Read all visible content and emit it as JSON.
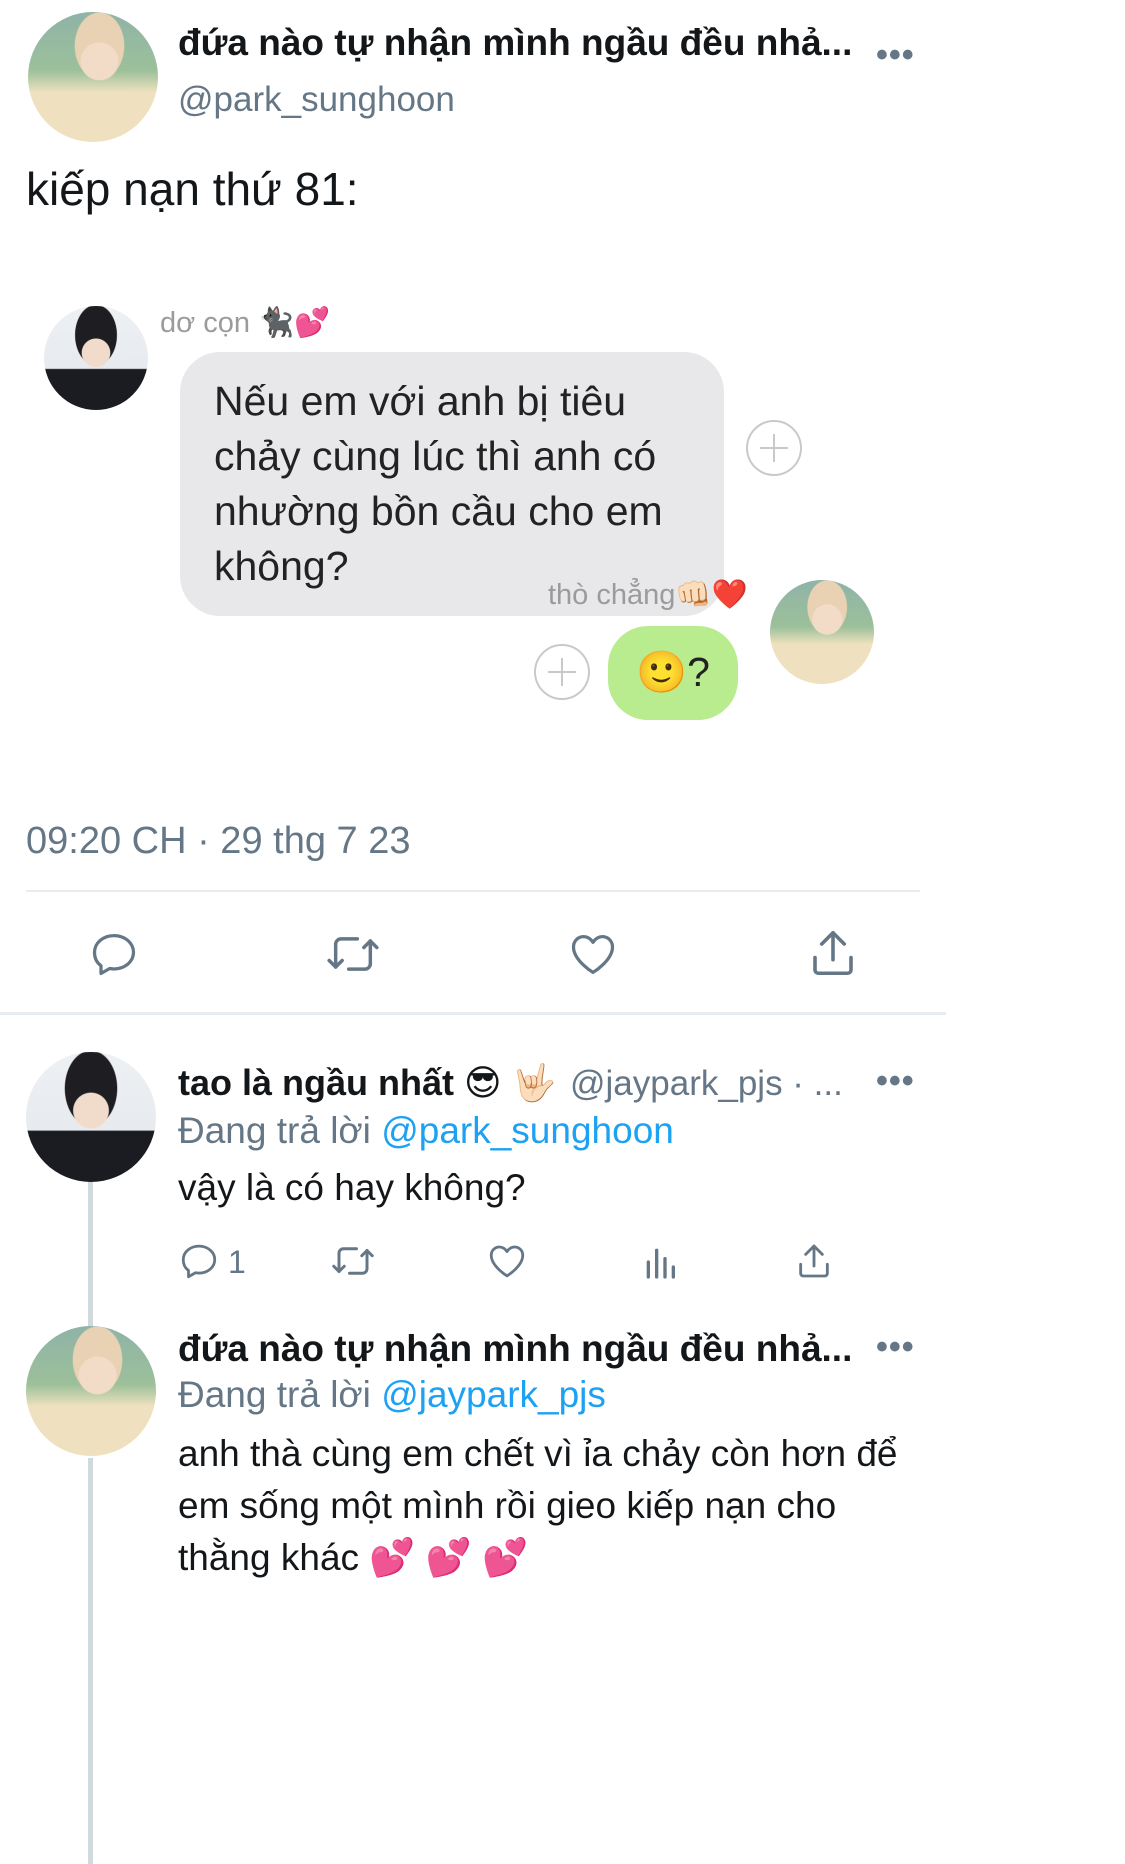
{
  "main_tweet": {
    "author_name": "đứa nào tự nhận mình ngầu đều nhả...",
    "author_handle": "@park_sunghoon",
    "more": "•••",
    "text": "kiếp nạn thứ 81:",
    "timestamp": "09:20 CH · 29 thg 7 23"
  },
  "chat": {
    "incoming_name": "dơ cọn 🐈‍⬛💕",
    "incoming_message": "Nếu em với anh bị tiêu chảy cùng lúc thì anh có nhường bồn cầu cho em không?",
    "outgoing_name": "thò chẳng👊🏻❤️",
    "outgoing_message": "🙂?"
  },
  "actions": {
    "reply_icon": "reply-icon",
    "retweet_icon": "retweet-icon",
    "like_icon": "heart-icon",
    "share_icon": "share-icon"
  },
  "replies": [
    {
      "author_name": "tao là ngầu nhất 😎 🤟🏻",
      "author_handle": "@jaypark_pjs · ...",
      "reply_prefix": "Đang trả lời ",
      "reply_mention": "@park_sunghoon",
      "text": "vậy là có hay không?",
      "reply_count": "1",
      "more": "•••"
    },
    {
      "author_name": "đứa nào tự nhận mình ngầu đều nhả...",
      "reply_prefix": "Đang trả lời ",
      "reply_mention": "@jaypark_pjs",
      "text": "anh thà cùng em chết vì ỉa chảy còn hơn để em sống một mình rồi gieo kiếp nạn cho thằng khác 💕 💕 💕",
      "more": "•••"
    }
  ],
  "colors": {
    "link": "#1da1f2",
    "secondary_text": "#657786",
    "green_bubble": "#b9ec8e",
    "gray_bubble": "#e8e8ea"
  }
}
